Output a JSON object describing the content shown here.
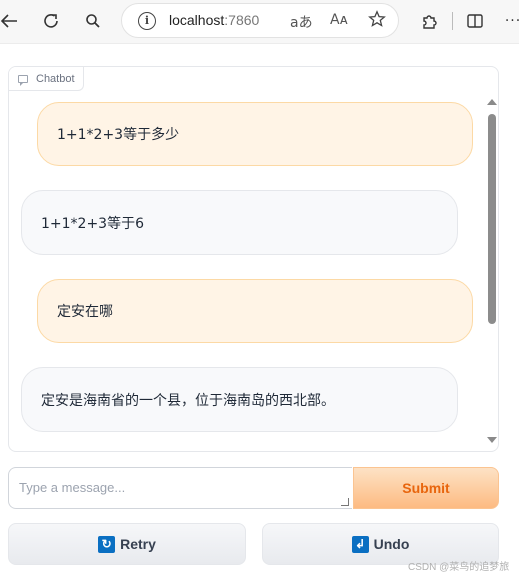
{
  "browser": {
    "url_host": "localhost",
    "url_port": ":7860",
    "read_aloud_label": "Aᴀ",
    "translate_label": "aあ"
  },
  "chatbot": {
    "label": "Chatbot",
    "messages": [
      {
        "role": "user",
        "text": "1+1*2+3等于多少"
      },
      {
        "role": "bot",
        "text": "1+1*2+3等于6"
      },
      {
        "role": "user",
        "text": "定安在哪"
      },
      {
        "role": "bot",
        "text": "定安是海南省的一个县，位于海南岛的西北部。"
      }
    ]
  },
  "input": {
    "placeholder": "Type a message...",
    "value": ""
  },
  "buttons": {
    "submit": "Submit",
    "retry": "Retry",
    "undo": "Undo"
  },
  "watermark": "CSDN @菜鸟的追梦旅行",
  "colors": {
    "accent": "#e8650d",
    "user_bubble": "#fff4e6",
    "bot_bubble": "#f8f9fb",
    "button_icon": "#0a6fc2"
  }
}
